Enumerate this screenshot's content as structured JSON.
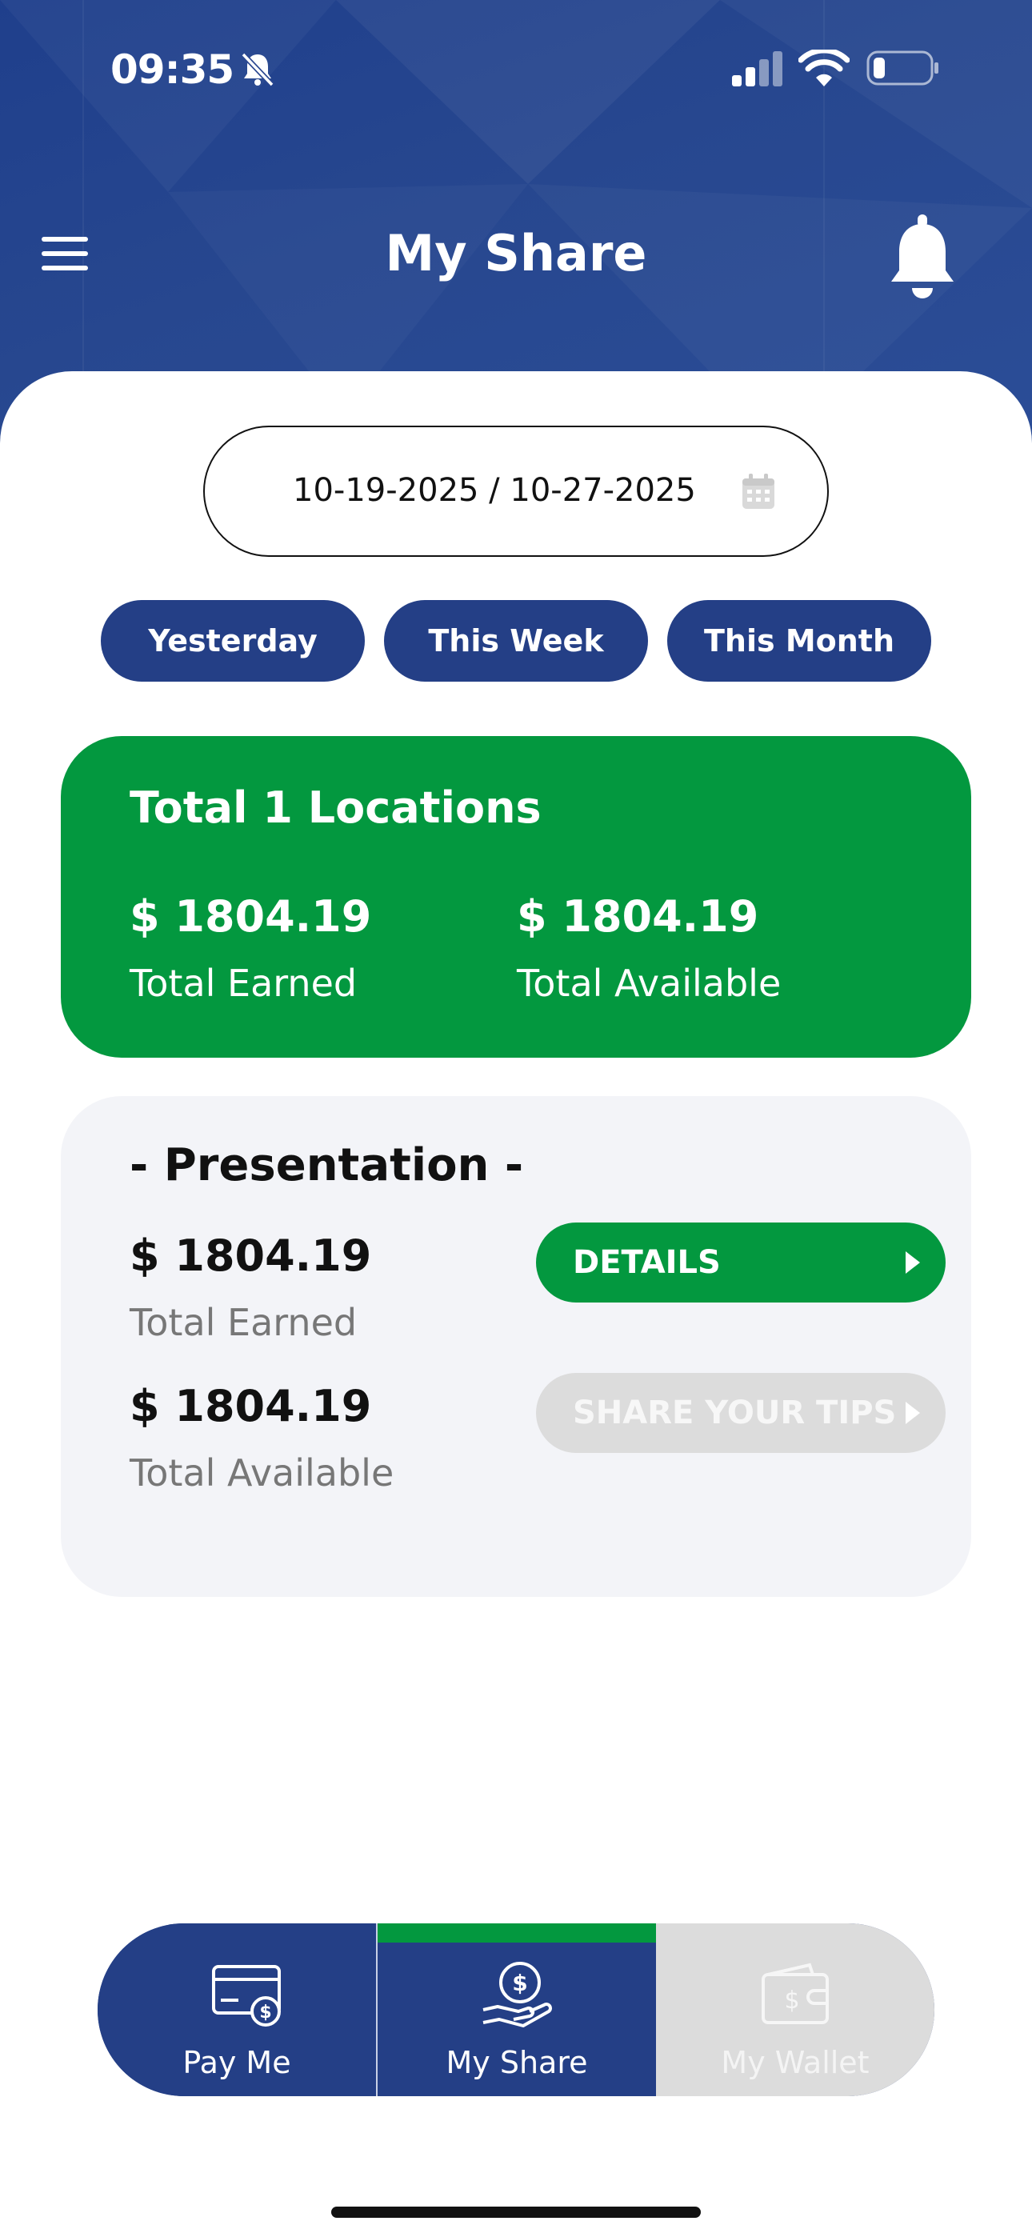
{
  "status_bar": {
    "time": "09:35"
  },
  "header": {
    "title": "My Share"
  },
  "date_range": {
    "value": "10-19-2025 / 10-27-2025"
  },
  "quick_ranges": [
    "Yesterday",
    "This Week",
    "This Month"
  ],
  "summary": {
    "title": "Total 1 Locations",
    "earned_amount": "$ 1804.19",
    "earned_label": "Total Earned",
    "available_amount": "$ 1804.19",
    "available_label": "Total Available"
  },
  "location": {
    "name": "- Presentation -",
    "earned_amount": "$ 1804.19",
    "earned_label": "Total Earned",
    "available_amount": "$ 1804.19",
    "available_label": "Total Available",
    "details_label": "DETAILS",
    "share_label": "SHARE YOUR TIPS"
  },
  "bottom_nav": {
    "items": [
      {
        "label": "Pay Me",
        "icon": "card-dollar-icon"
      },
      {
        "label": "My Share",
        "icon": "hand-coin-icon"
      },
      {
        "label": "My Wallet",
        "icon": "wallet-icon"
      }
    ],
    "active": "My Share"
  },
  "colors": {
    "brand_blue": "#243f86",
    "brand_green": "#03983f",
    "disabled_gray": "#dcdcdc"
  }
}
